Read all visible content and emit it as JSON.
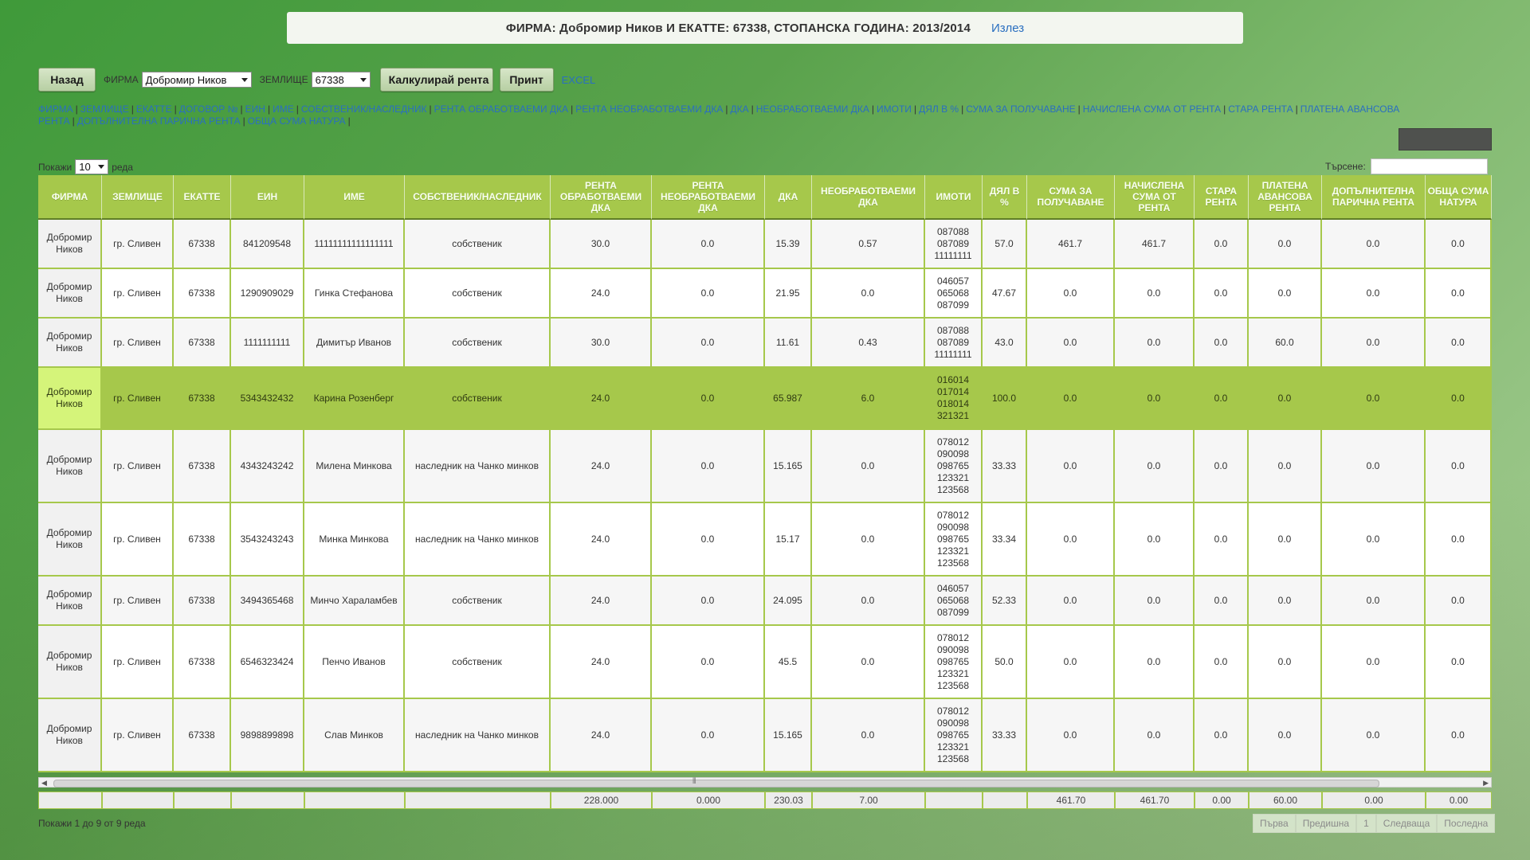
{
  "header": {
    "title": "ФИРМА: Добромир Ников И ЕКАТТЕ: 67338, СТОПАНСКА ГОДИНА: 2013/2014",
    "logout": "Излез"
  },
  "toolbar": {
    "back": "Назад",
    "firm_label": "ФИРМА",
    "firm_value": "Добромир Ников",
    "land_label": "ЗЕМЛИЩЕ",
    "land_value": "67338",
    "calc": "Калкулирай рента",
    "print": "Принт",
    "excel": "EXCEL"
  },
  "column_toggles": [
    "ФИРМА",
    "ЗЕМЛИЩЕ",
    "ЕКАТТЕ",
    "ДОГОВОР №",
    "ЕИН",
    "ИМЕ",
    "СОБСТВЕНИК/НАСЛЕДНИК",
    "РЕНТА ОБРАБОТВАЕМИ ДКА",
    "РЕНТА НЕОБРАБОТВАЕМИ ДКА",
    "ДКА",
    "НЕОБРАБОТВАЕМИ ДКА",
    "ИМОТИ",
    "ДЯЛ В %",
    "СУМА ЗА ПОЛУЧАВАНЕ",
    "НАЧИСЛЕНА СУМА ОТ РЕНТА",
    "СТАРА РЕНТА",
    "ПЛАТЕНА АВАНСОВА РЕНТА",
    "ДОПЪЛНИТЕЛНА ПАРИЧНА РЕНТА",
    "ОБЩА СУМА НАТУРА"
  ],
  "length": {
    "show": "Покажи",
    "value": "10",
    "rows": "реда"
  },
  "search": {
    "label": "Търсене:"
  },
  "columns": [
    "ФИРМА",
    "ЗЕМЛИЩЕ",
    "ЕКАТТЕ",
    "ЕИН",
    "ИМЕ",
    "СОБСТВЕНИК/НАСЛЕДНИК",
    "РЕНТА ОБРАБОТВАЕМИ ДКА",
    "РЕНТА НЕОБРАБОТВАЕМИ ДКА",
    "ДКА",
    "НЕОБРАБОТВАЕМИ ДКА",
    "ИМОТИ",
    "ДЯЛ В %",
    "СУМА ЗА ПОЛУЧАВАНЕ",
    "НАЧИСЛЕНА СУМА ОТ РЕНТА",
    "СТАРА РЕНТА",
    "ПЛАТЕНА АВАНСОВА РЕНТА",
    "ДОПЪЛНИТЕЛНА ПАРИЧНА РЕНТА",
    "ОБЩА СУМА НАТУРА"
  ],
  "rows": [
    [
      "Добромир Ников",
      "гр. Сливен",
      "67338",
      "841209548",
      "11111111111111111",
      "собственик",
      "30.0",
      "0.0",
      "15.39",
      "0.57",
      "087088\n087089\n11111111",
      "57.0",
      "461.7",
      "461.7",
      "0.0",
      "0.0",
      "0.0",
      "0.0"
    ],
    [
      "Добромир Ников",
      "гр. Сливен",
      "67338",
      "1290909029",
      "Гинка Стефанова",
      "собственик",
      "24.0",
      "0.0",
      "21.95",
      "0.0",
      "046057\n065068\n087099",
      "47.67",
      "0.0",
      "0.0",
      "0.0",
      "0.0",
      "0.0",
      "0.0"
    ],
    [
      "Добромир Ников",
      "гр. Сливен",
      "67338",
      "1111111111",
      "Димитър Иванов",
      "собственик",
      "30.0",
      "0.0",
      "11.61",
      "0.43",
      "087088\n087089\n11111111",
      "43.0",
      "0.0",
      "0.0",
      "0.0",
      "60.0",
      "0.0",
      "0.0"
    ],
    [
      "Добромир Ников",
      "гр. Сливен",
      "67338",
      "5343432432",
      "Карина Розенберг",
      "собственик",
      "24.0",
      "0.0",
      "65.987",
      "6.0",
      "016014\n017014\n018014\n321321",
      "100.0",
      "0.0",
      "0.0",
      "0.0",
      "0.0",
      "0.0",
      "0.0"
    ],
    [
      "Добромир Ников",
      "гр. Сливен",
      "67338",
      "4343243242",
      "Милена Минкова",
      "наследник на Чанко минков",
      "24.0",
      "0.0",
      "15.165",
      "0.0",
      "078012\n090098\n098765\n123321\n123568",
      "33.33",
      "0.0",
      "0.0",
      "0.0",
      "0.0",
      "0.0",
      "0.0"
    ],
    [
      "Добромир Ников",
      "гр. Сливен",
      "67338",
      "3543243243",
      "Минка Минкова",
      "наследник на Чанко минков",
      "24.0",
      "0.0",
      "15.17",
      "0.0",
      "078012\n090098\n098765\n123321\n123568",
      "33.34",
      "0.0",
      "0.0",
      "0.0",
      "0.0",
      "0.0",
      "0.0"
    ],
    [
      "Добромир Ников",
      "гр. Сливен",
      "67338",
      "3494365468",
      "Минчо Хараламбев",
      "собственик",
      "24.0",
      "0.0",
      "24.095",
      "0.0",
      "046057\n065068\n087099",
      "52.33",
      "0.0",
      "0.0",
      "0.0",
      "0.0",
      "0.0",
      "0.0"
    ],
    [
      "Добромир Ников",
      "гр. Сливен",
      "67338",
      "6546323424",
      "Пенчо Иванов",
      "собственик",
      "24.0",
      "0.0",
      "45.5",
      "0.0",
      "078012\n090098\n098765\n123321\n123568",
      "50.0",
      "0.0",
      "0.0",
      "0.0",
      "0.0",
      "0.0",
      "0.0"
    ],
    [
      "Добромир Ников",
      "гр. Сливен",
      "67338",
      "9898899898",
      "Слав Минков",
      "наследник на Чанко минков",
      "24.0",
      "0.0",
      "15.165",
      "0.0",
      "078012\n090098\n098765\n123321\n123568",
      "33.33",
      "0.0",
      "0.0",
      "0.0",
      "0.0",
      "0.0",
      "0.0"
    ]
  ],
  "selected_row": 3,
  "totals": [
    "",
    "",
    "",
    "",
    "",
    "",
    "228.000",
    "0.000",
    "230.03",
    "7.00",
    "",
    "",
    "461.70",
    "461.70",
    "0.00",
    "60.00",
    "0.00",
    "0.00"
  ],
  "info": "Покажи 1 до 9 от 9 реда",
  "pager": {
    "first": "Първа",
    "prev": "Предишна",
    "page": "1",
    "next": "Следваща",
    "last": "Последна"
  },
  "colors": {
    "header_green": "#a6c84b",
    "selected_first": "#d5f47a",
    "link_blue": "#2a6fc0"
  }
}
